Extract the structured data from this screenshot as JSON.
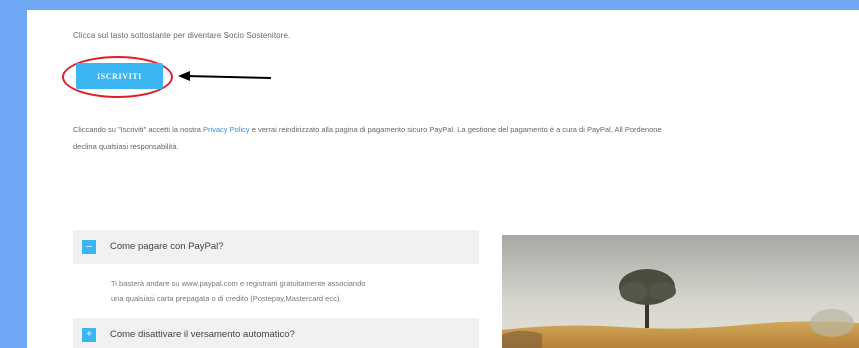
{
  "intro_text": "Clicca sul tasto sottostante per diventare Socio Sostenitore.",
  "subscribe_button": "ISCRIVITI",
  "notice": {
    "before_link": "Cliccando su \"Iscriviti\" accetti la nostra ",
    "link": "Privacy Policy",
    "after_link": " e verrai reindirizzato alla pagina di pagamento sicuro PayPal. La gestione del pagamento è a cura di PayPal, All Pordenone",
    "line2": "declina qualsiasi responsabilità."
  },
  "faq": [
    {
      "toggle": "–",
      "title": "Come pagare con PayPal?",
      "body_line1": "Ti basterà andare su www.paypal.com e registrarti gratuitamente associando",
      "body_line2": "una qualsiasi carta prepagata o di credito (Postepay,Mastercard ecc)."
    },
    {
      "toggle": "+",
      "title": "Come disattivare il versamento automatico?"
    }
  ],
  "colors": {
    "frame_background": "#6fa7f5",
    "button": "#3bb6f2",
    "link": "#3a8ee0",
    "annotation": "#dd1f2b"
  }
}
